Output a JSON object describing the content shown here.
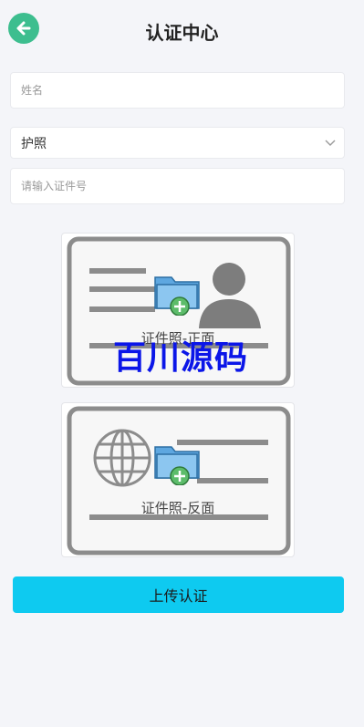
{
  "header": {
    "title": "认证中心",
    "back_icon": "arrow-left-icon"
  },
  "form": {
    "name_placeholder": "姓名",
    "id_type_selected": "护照",
    "id_number_placeholder": "请输入证件号"
  },
  "uploads": {
    "front_label": "证件照-正面",
    "back_label": "证件照-反面"
  },
  "watermark": "百川源码",
  "submit_label": "上传认证",
  "colors": {
    "accent_green": "#3dbe8f",
    "primary_button": "#0ecaf0",
    "watermark_blue": "#0b16e8"
  }
}
